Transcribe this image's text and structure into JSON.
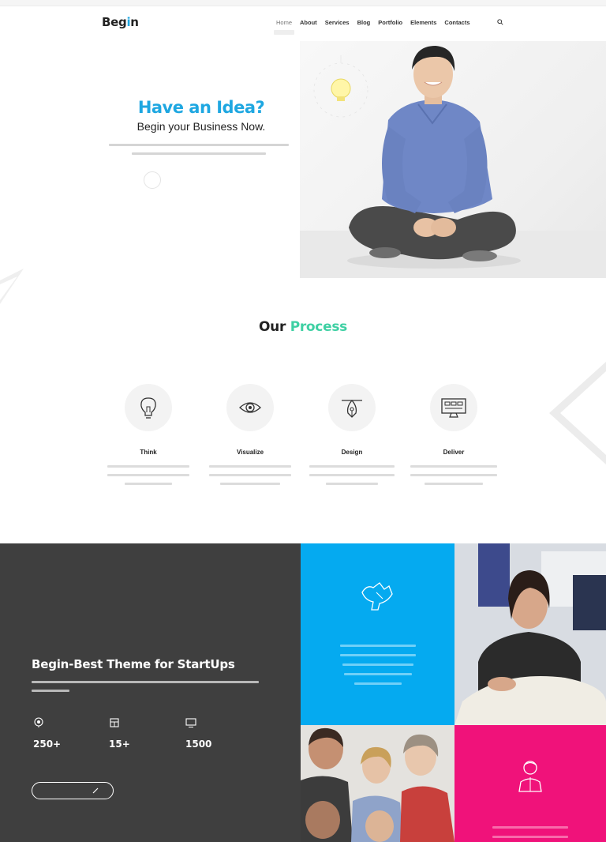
{
  "header": {
    "logo_main": "Beg",
    "logo_accent": "i",
    "logo_end": "n",
    "nav": [
      "Home",
      "About",
      "Services",
      "Blog",
      "Portfolio",
      "Elements",
      "Contacts"
    ]
  },
  "hero": {
    "title": "Have an Idea?",
    "subtitle": "Begin your Business Now."
  },
  "process": {
    "title_main": "Our",
    "title_accent": "Process",
    "steps": [
      {
        "name": "Think",
        "icon": "lightbulb-icon"
      },
      {
        "name": "Visualize",
        "icon": "eye-icon"
      },
      {
        "name": "Design",
        "icon": "pen-nib-icon"
      },
      {
        "name": "Deliver",
        "icon": "monitor-icon"
      }
    ]
  },
  "about": {
    "title": "Begin-Best Theme for StartUps",
    "stats": [
      {
        "num": "250+",
        "icon": "trophy-icon"
      },
      {
        "num": "15+",
        "icon": "briefcase-icon"
      },
      {
        "num": "1500",
        "icon": "monitor-icon"
      }
    ]
  },
  "colors": {
    "accent_blue": "#1ea7e1",
    "accent_green": "#3ed0a3",
    "dark_panel": "#3f3f3f",
    "blue_panel": "#05aaf0",
    "pink_panel": "#f0127a"
  }
}
